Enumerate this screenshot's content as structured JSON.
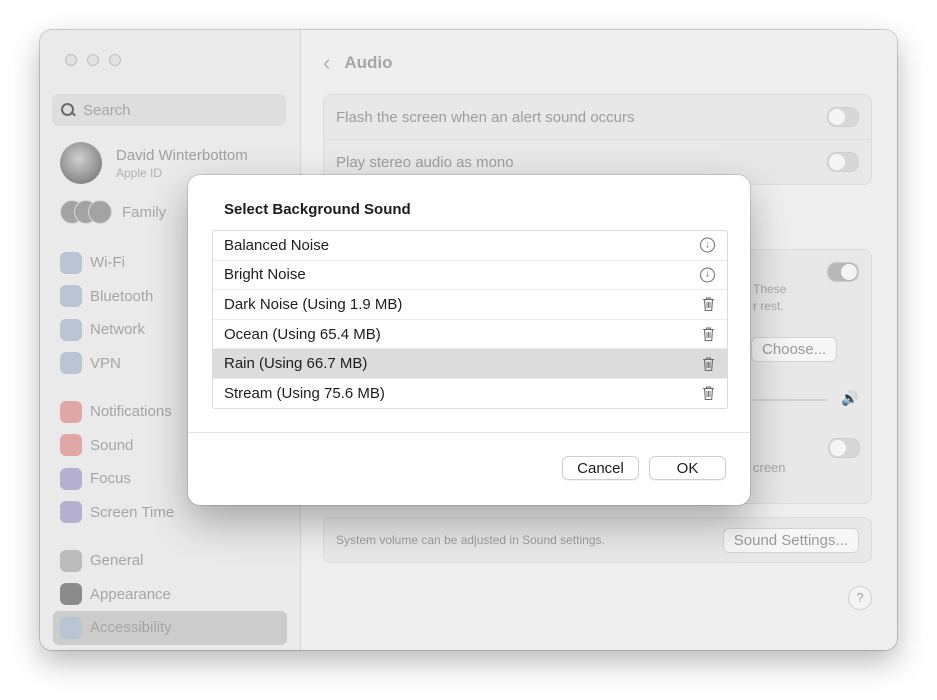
{
  "sidebar": {
    "search_placeholder": "Search",
    "user_name": "David Winterbottom",
    "user_subtitle": "Apple ID",
    "family_label": "Family",
    "nav": [
      {
        "label": "Wi-Fi",
        "icon": "wifi-icon",
        "color": "#b9c4d4"
      },
      {
        "label": "Bluetooth",
        "icon": "bluetooth-icon",
        "color": "#b9c4d4"
      },
      {
        "label": "Network",
        "icon": "globe-icon",
        "color": "#b9c4d4"
      },
      {
        "label": "VPN",
        "icon": "globe-icon",
        "color": "#b9c4d4"
      },
      {
        "label": "Notifications",
        "icon": "bell-icon",
        "color": "#e1a7a7"
      },
      {
        "label": "Sound",
        "icon": "speaker-icon",
        "color": "#e1a7a7"
      },
      {
        "label": "Focus",
        "icon": "moon-icon",
        "color": "#b5afd2"
      },
      {
        "label": "Screen Time",
        "icon": "hourglass-icon",
        "color": "#b5afd2"
      },
      {
        "label": "General",
        "icon": "gear-icon",
        "color": "#bcbcbc"
      },
      {
        "label": "Appearance",
        "icon": "appearance-icon",
        "color": "#8b8b8b"
      },
      {
        "label": "Accessibility",
        "icon": "accessibility-icon",
        "color": "#b9c4d4"
      }
    ]
  },
  "content": {
    "title": "Audio",
    "rows": {
      "flash_screen": "Flash the screen when an alert sound occurs",
      "stereo_mono": "Play stereo audio as mono"
    },
    "partial_texts": [
      "These",
      "r rest.",
      "n",
      "creen"
    ],
    "choose_button": "Choose...",
    "volume_note": "System volume can be adjusted in Sound settings.",
    "sound_settings_button": "Sound Settings...",
    "help_glyph": "?"
  },
  "dialog": {
    "title": "Select Background Sound",
    "sounds": [
      {
        "label": "Balanced Noise",
        "action": "download-icon"
      },
      {
        "label": "Bright Noise",
        "action": "download-icon"
      },
      {
        "label": "Dark Noise (Using 1.9 MB)",
        "action": "trash-icon"
      },
      {
        "label": "Ocean (Using 65.4 MB)",
        "action": "trash-icon"
      },
      {
        "label": "Rain (Using 66.7 MB)",
        "action": "trash-icon",
        "selected": true
      },
      {
        "label": "Stream (Using 75.6 MB)",
        "action": "trash-icon"
      }
    ],
    "cancel_label": "Cancel",
    "ok_label": "OK"
  }
}
